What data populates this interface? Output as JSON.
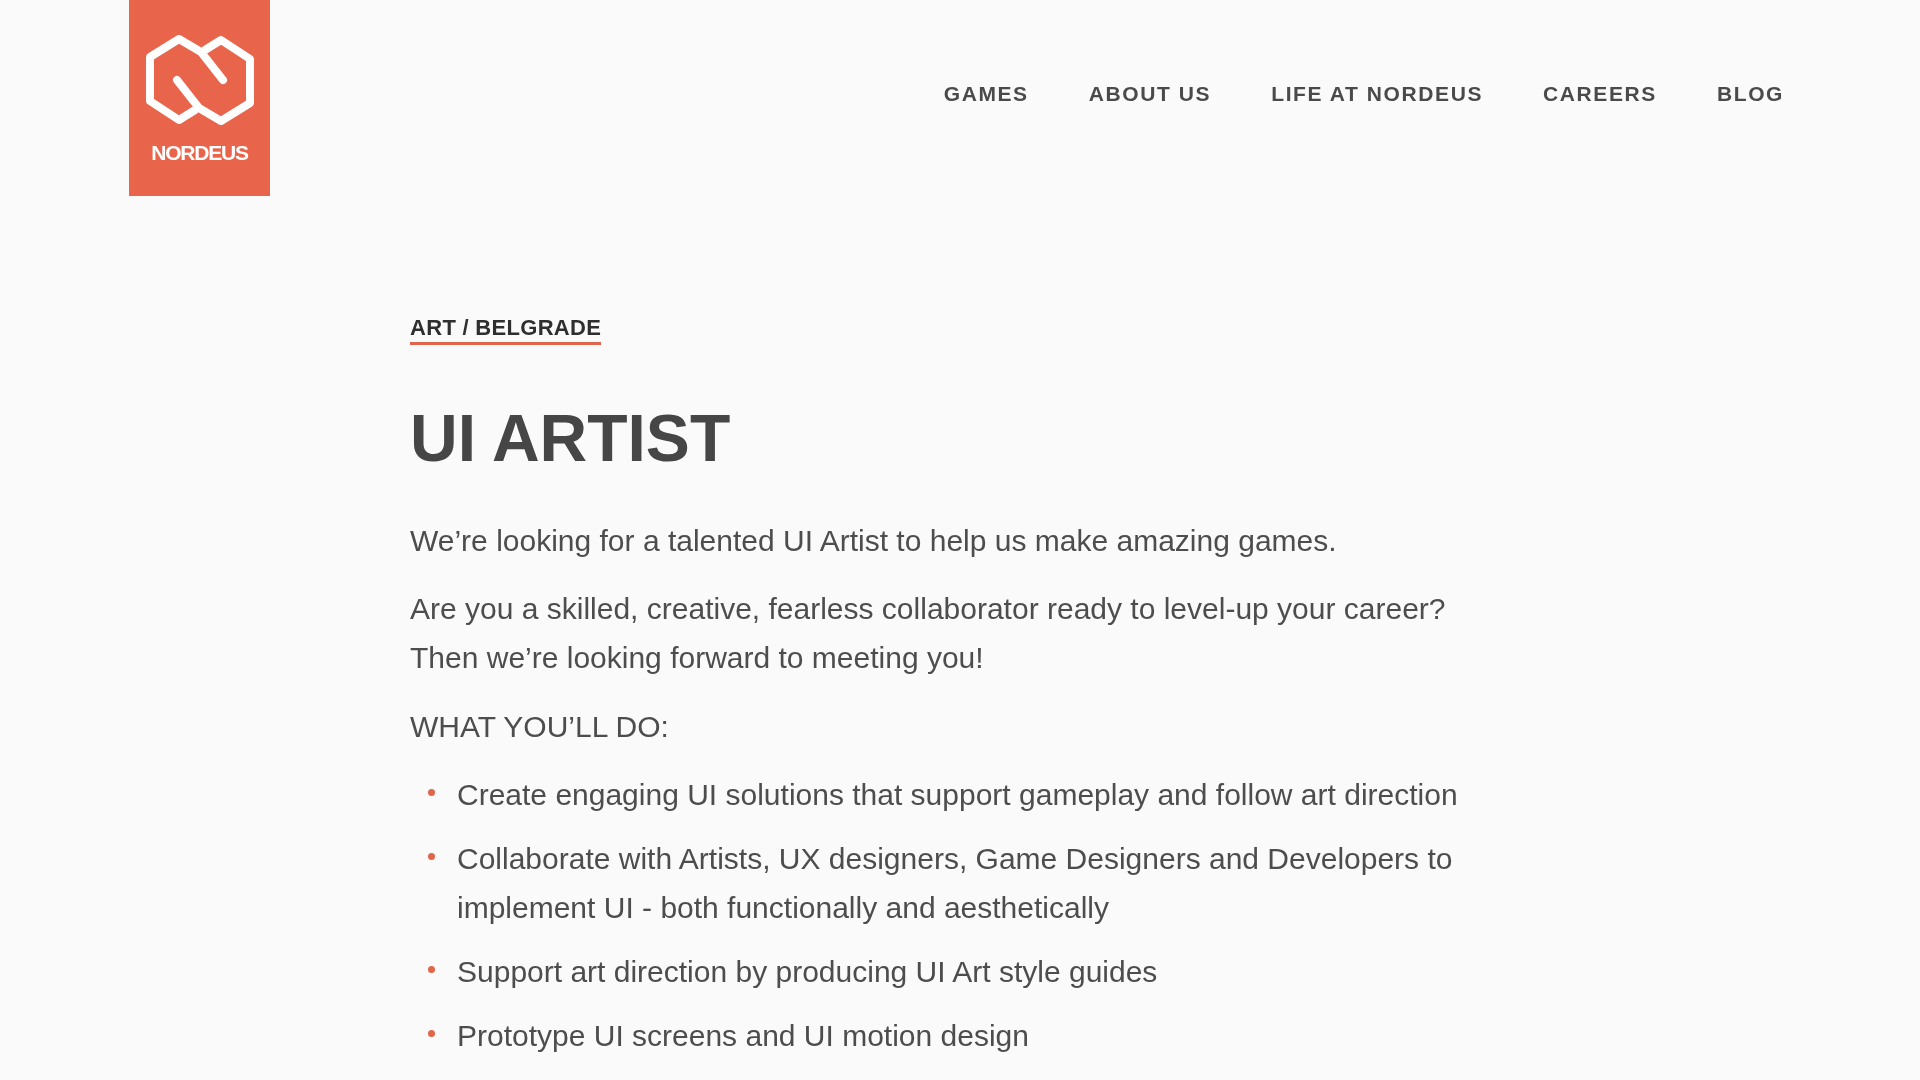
{
  "logo": {
    "text": "NORDEUS"
  },
  "nav": [
    "GAMES",
    "ABOUT US",
    "LIFE AT NORDEUS",
    "CAREERS",
    "BLOG"
  ],
  "job": {
    "category": "ART / BELGRADE",
    "title": "UI ARTIST",
    "paragraphs": [
      "We’re looking for a talented UI Artist to help us make amazing games.",
      "Are you a skilled, creative, fearless collaborator ready to level-up your career? Then we’re looking forward to meeting you!"
    ],
    "section_heading": "WHAT YOU’LL DO:",
    "duties": [
      "Create engaging UI solutions that support gameplay and follow art direction",
      "Collaborate with Artists, UX designers, Game Designers and Developers to implement UI - both functionally and aesthetically",
      "Support art direction by producing UI Art style guides",
      "Prototype UI screens and UI motion design"
    ]
  }
}
